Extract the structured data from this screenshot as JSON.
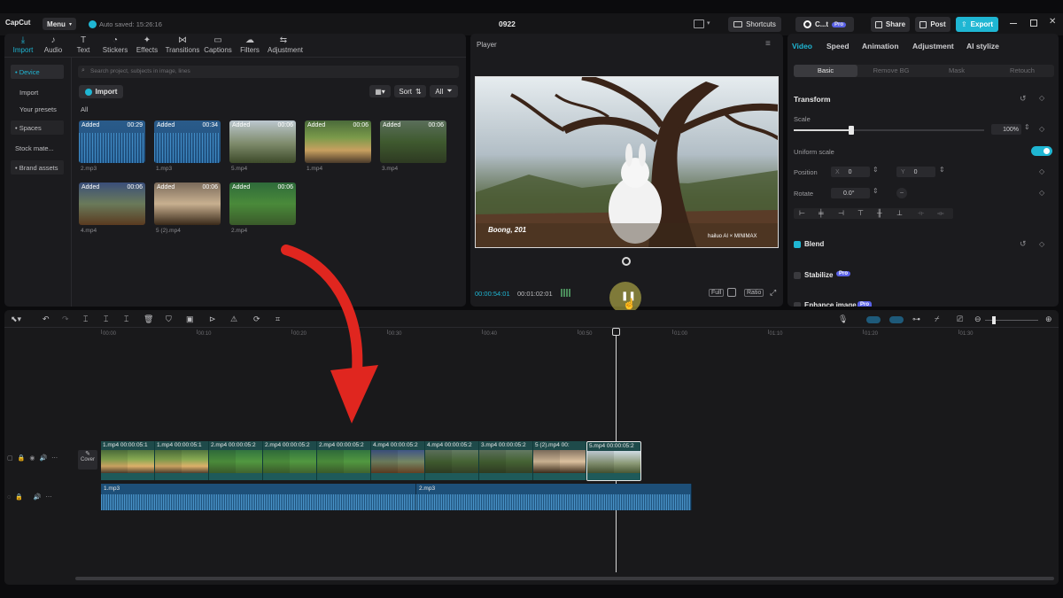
{
  "app": {
    "logo": "CapCut",
    "menu_label": "Menu",
    "autosave": "Auto saved: 15:26:16",
    "project_title": "0922"
  },
  "topbar": {
    "shortcuts": "Shortcuts",
    "account": "C...t",
    "pro_badge": "Pro",
    "share": "Share",
    "post": "Post",
    "export": "Export"
  },
  "tools": [
    {
      "label": "Import",
      "icon": "import-icon",
      "active": true
    },
    {
      "label": "Audio",
      "icon": "audio-icon"
    },
    {
      "label": "Text",
      "icon": "text-icon"
    },
    {
      "label": "Stickers",
      "icon": "stickers-icon"
    },
    {
      "label": "Effects",
      "icon": "effects-icon"
    },
    {
      "label": "Transitions",
      "icon": "transitions-icon"
    },
    {
      "label": "Captions",
      "icon": "captions-icon"
    },
    {
      "label": "Filters",
      "icon": "filters-icon"
    },
    {
      "label": "Adjustment",
      "icon": "adjustment-icon"
    }
  ],
  "sidebar": {
    "items": [
      "• Device",
      "Import",
      "Your presets",
      "• Spaces",
      "Stock mate...",
      "• Brand assets"
    ]
  },
  "media": {
    "search_placeholder": "Search project, subjects in image, lines",
    "import_label": "Import",
    "sort_label": "Sort",
    "all_filter": "All",
    "all_heading": "All",
    "items": [
      {
        "name": "2.mp3",
        "tag": "Added",
        "dur": "00:29"
      },
      {
        "name": "1.mp3",
        "tag": "Added",
        "dur": "00:34"
      },
      {
        "name": "5.mp4",
        "tag": "Added",
        "dur": "00:06"
      },
      {
        "name": "1.mp4",
        "tag": "Added",
        "dur": "00:06"
      },
      {
        "name": "3.mp4",
        "tag": "Added",
        "dur": "00:06"
      },
      {
        "name": "4.mp4",
        "tag": "Added",
        "dur": "00:06"
      },
      {
        "name": "5 (2).mp4",
        "tag": "Added",
        "dur": "00:06"
      },
      {
        "name": "2.mp4",
        "tag": "Added",
        "dur": "00:06"
      }
    ]
  },
  "player": {
    "title": "Player",
    "caption": "Boong, 201",
    "watermark": "hailuo AI × MINIMAX",
    "current_time": "00:00:54:01",
    "total_time": "00:01:02:01",
    "full": "Full",
    "ratio": "Ratio"
  },
  "inspector": {
    "tabs": [
      "Video",
      "Speed",
      "Animation",
      "Adjustment",
      "AI stylize"
    ],
    "subtabs": [
      "Basic",
      "Remove BG",
      "Mask",
      "Retouch"
    ],
    "transform": "Transform",
    "scale_label": "Scale",
    "scale_value": "100%",
    "scale_fraction": 0.3,
    "uniform_scale": "Uniform scale",
    "position_label": "Position",
    "pos_x_label": "X",
    "pos_x": "0",
    "pos_y_label": "Y",
    "pos_y": "0",
    "rotate_label": "Rotate",
    "rotate_value": "0.0°",
    "blend": "Blend",
    "stabilize": "Stabilize",
    "enhance": "Enhance image",
    "pro": "Pro"
  },
  "timeline": {
    "ruler": [
      "00:00",
      "00:10",
      "00:20",
      "00:30",
      "00:40",
      "00:50",
      "01:00",
      "01:10",
      "01:20",
      "01:30"
    ],
    "cover_label": "Cover",
    "video_clips": [
      {
        "label": "1.mp4  00:00:05:1"
      },
      {
        "label": "1.mp4  00:00:05:1"
      },
      {
        "label": "2.mp4  00:00:05:2"
      },
      {
        "label": "2.mp4  00:00:05:2"
      },
      {
        "label": "2.mp4  00:00:05:2"
      },
      {
        "label": "4.mp4  00:00:05:2"
      },
      {
        "label": "4.mp4  00:00:05:2"
      },
      {
        "label": "3.mp4  00:00:05:2"
      },
      {
        "label": "5 (2).mp4  00:"
      },
      {
        "label": "5.mp4  00:00:05:2"
      }
    ],
    "audio_clips": [
      {
        "label": "1.mp3"
      },
      {
        "label": "2.mp3"
      }
    ]
  },
  "colors": {
    "accent": "#1fb6d3",
    "annotation_arrow": "#e0261f",
    "track_teal": "#1e5a5a",
    "audio_blue": "#1d4f78"
  }
}
